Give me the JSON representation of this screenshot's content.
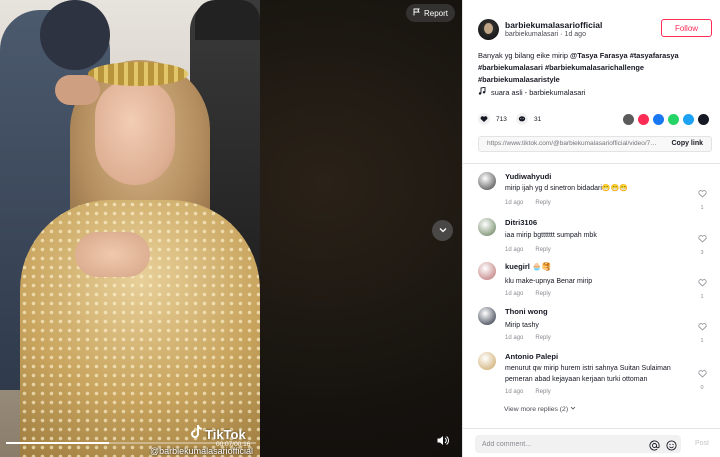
{
  "video": {
    "report_label": "Report",
    "watermark_name": "TikTok",
    "watermark_handle": "@barbiekumalasariofficial",
    "timecode": "00:07/00:16",
    "progress": 0.41
  },
  "author": {
    "handle": "barbiekumalasariofficial",
    "name": "barbiekumalasari",
    "time": "1d ago",
    "follow_label": "Follow"
  },
  "caption": {
    "text": "Banyak yg bilang eike mirip",
    "mention": "@Tasya Farasya",
    "hashtags_line1": "#tasyafarasya",
    "hashtags_line2": "#barbiekumalasari #barbiekumalasarichallenge",
    "hashtags_line3": "#barbiekumalasaristyle"
  },
  "sound": {
    "icon": "music-note-icon",
    "label": "suara asli - barbiekumalasari"
  },
  "actions": {
    "likes": "713",
    "comments": "31"
  },
  "share": {
    "colors": [
      "#5b5b5b",
      "#fe2c55",
      "#1877f2",
      "#25d366",
      "#1da1f2",
      "#161823"
    ]
  },
  "link": {
    "url": "https://www.tiktok.com/@barbiekumalasariofficial/video/71...",
    "copy_label": "Copy link"
  },
  "comments": [
    {
      "name": "Yudiwahyudi",
      "text": "mirip ijah yg d sinetron bidadari😁😁😁",
      "time": "1d ago",
      "reply": "Reply",
      "likes": "1",
      "avatar_color": "#3a3a3a"
    },
    {
      "name": "Ditri3106",
      "text": "iaa mirip bgttttttt sumpah mbk",
      "time": "1d ago",
      "reply": "Reply",
      "likes": "3",
      "avatar_color": "#5e7a52"
    },
    {
      "name": "kuegirl 🧁🥞",
      "text": "klu make-upnya Benar mirip",
      "time": "1d ago",
      "reply": "Reply",
      "likes": "1",
      "avatar_color": "#b86c6c"
    },
    {
      "name": "Thoni wong",
      "text": "Mirip tashy",
      "time": "1d ago",
      "reply": "Reply",
      "likes": "1",
      "avatar_color": "#20283a"
    },
    {
      "name": "Antonio Palepi",
      "text": "menurut qw mirip hurem istri sahnya Suitan Sulaiman pemeran abad kejayaan kerjaan turki ottoman",
      "time": "1d ago",
      "reply": "Reply",
      "likes": "0",
      "avatar_color": "#c9a25e"
    }
  ],
  "view_more": "View more replies (2)",
  "comment_bar": {
    "placeholder": "Add comment...",
    "post_label": "Post"
  }
}
